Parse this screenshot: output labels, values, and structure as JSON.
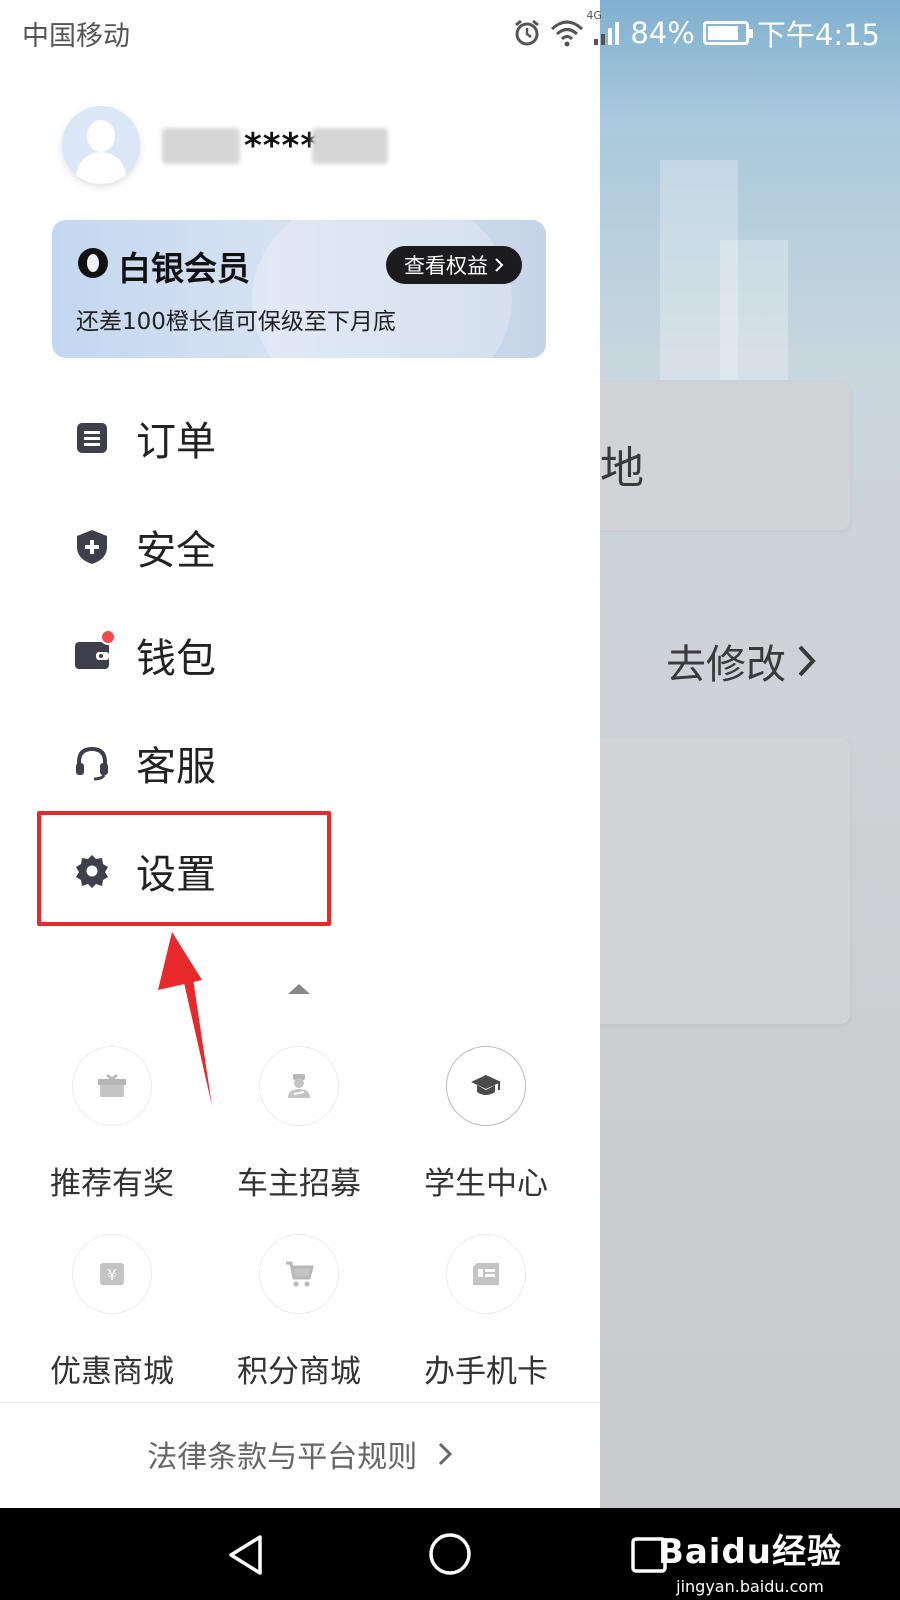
{
  "status_bar": {
    "carrier": "中国移动",
    "network": "4G",
    "battery": "84%",
    "battery_level": 0.84,
    "time": "下午4:15"
  },
  "background": {
    "card_text": "地",
    "edit_link": "去修改"
  },
  "profile": {
    "username_masked": "****"
  },
  "membership": {
    "title": "白银会员",
    "benefits_button": "查看权益",
    "subtitle": "还差100橙长值可保级至下月底"
  },
  "menu": [
    {
      "label": "订单",
      "icon": "order-icon"
    },
    {
      "label": "安全",
      "icon": "shield-icon"
    },
    {
      "label": "钱包",
      "icon": "wallet-icon"
    },
    {
      "label": "客服",
      "icon": "headset-icon"
    },
    {
      "label": "设置",
      "icon": "gear-icon"
    }
  ],
  "grid": [
    {
      "label": "推荐有奖",
      "icon": "gift-icon"
    },
    {
      "label": "车主招募",
      "icon": "driver-icon"
    },
    {
      "label": "学生中心",
      "icon": "graduation-cap-icon"
    },
    {
      "label": "优惠商城",
      "icon": "yuan-icon"
    },
    {
      "label": "积分商城",
      "icon": "cart-icon"
    },
    {
      "label": "办手机卡",
      "icon": "sim-card-icon"
    }
  ],
  "footer": {
    "legal": "法律条款与平台规则"
  },
  "watermark": {
    "main": "Baidu经验",
    "sub": "jingyan.baidu.com"
  },
  "colors": {
    "highlight": "#e8292b",
    "badge": "#f04a4a",
    "icon": "#3d3f4a"
  }
}
